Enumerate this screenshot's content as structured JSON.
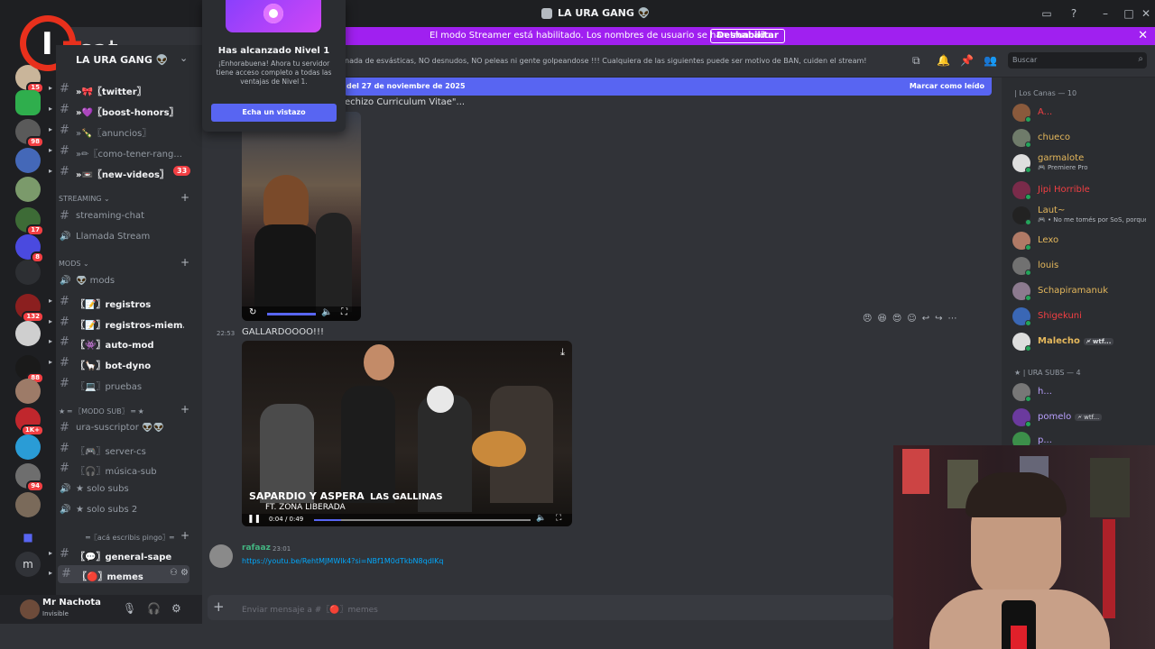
{
  "window": {
    "title": "LA URA GANG 👽"
  },
  "banner": {
    "text": "El modo Streamer está habilitado. Los nombres de usuario se han truncado.",
    "button": "Deshabilitar"
  },
  "logo": {
    "text": "I-sat"
  },
  "popup": {
    "title": "Has alcanzado Nivel 1",
    "body": "¡Enhorabuena! Ahora tu servidor tiene acceso completo a todas las ventajas de Nivel 1.",
    "button": "Echa un vistazo"
  },
  "server": {
    "name": "LA URA GANG 👽"
  },
  "rail_badges": [
    "15",
    "98",
    "17",
    "8",
    "132",
    "88",
    "1K+",
    "94"
  ],
  "channels_top": [
    {
      "label": "»🎀〖twitter〗",
      "bold": true
    },
    {
      "label": "»💜〖boost-honors〗",
      "bold": true
    },
    {
      "label": "»🍾〖anuncios〗",
      "bold": false
    },
    {
      "label": "»✏〖como-tener-rang...",
      "bold": false
    },
    {
      "label": "»📼〖new-videos〗",
      "bold": true,
      "mentions": "33"
    }
  ],
  "streaming": {
    "category": "STREAMING",
    "channels": [
      "streaming-chat",
      "Llamada Stream"
    ]
  },
  "mods": {
    "category": "mods",
    "channels": [
      {
        "label": "👽 mods",
        "bold": false
      },
      {
        "label": "〖📝〗registros",
        "bold": true
      },
      {
        "label": "〖📝〗registros-miem...",
        "bold": true
      },
      {
        "label": "〖👾〗auto-mod",
        "bold": true
      },
      {
        "label": "〖🦙〗bot-dyno",
        "bold": true
      },
      {
        "label": "〖💻〗pruebas",
        "bold": false
      }
    ]
  },
  "modosub": {
    "category": "★ ═ 〖MODO SUB〗 ═ ★",
    "channels": [
      {
        "label": "ura-suscriptor 👽👽",
        "bold": false
      },
      {
        "label": "〖🎮〗server-cs",
        "bold": false
      },
      {
        "label": "〖🎧〗música-sub",
        "bold": false
      },
      {
        "label": "★ solo subs",
        "bold": false
      },
      {
        "label": "★ solo subs 2",
        "bold": false
      }
    ]
  },
  "acaescribis": {
    "category": "═〖acá escribis pingo〗═",
    "channels": [
      {
        "label": "〖💬〗general-sape",
        "bold": true
      },
      {
        "label": "〖🔴〗memes",
        "bold": true,
        "active": true
      }
    ]
  },
  "user": {
    "name": "Mr Nachota",
    "status": "Invisible"
  },
  "header": {
    "topic": "nada de esvásticas, NO desnudos, NO peleas ni gente golpeandose !!! Cualquiera de las siguientes puede ser motivo de BAN, cuiden el stream!",
    "search_placeholder": "Buscar"
  },
  "newbar": {
    "left": "del 27 de noviembre de 2025",
    "right": "Marcar como leído"
  },
  "messages": {
    "first_text": "echizo Curriculum Vitae\"...",
    "msg2_time": "22:53",
    "msg2_text": "GALLARDOOOO!!!",
    "video2_caption1": "SAPARDIO Y ASPERA",
    "video2_caption2": "LAS GALLINAS",
    "video2_caption3": "FT. ZONA LIBERADA",
    "video2_time": "0:04 / 0:49",
    "msg3_author": "rafaaz",
    "msg3_time": "23:01",
    "msg3_link": "https://youtu.be/RehtMJMWlk4?si=NBf1M0dTkbN8qdIKq"
  },
  "composer": {
    "placeholder": "Enviar mensaje a #〖🔴〗memes"
  },
  "members": {
    "group1": "| Los Canas — 10",
    "group2": "★ | URA SUBS — 4",
    "list1": [
      {
        "name": "A...",
        "color": "#f23f43",
        "sub": "",
        "tag": "",
        "av": "#8a5a3c"
      },
      {
        "name": "chueco",
        "color": "#e5b85c",
        "sub": "",
        "tag": "",
        "av": "#6f7b6a"
      },
      {
        "name": "garmalote",
        "color": "#e5b85c",
        "sub": "🎮 Premiere Pro",
        "tag": "",
        "av": "#dedede"
      },
      {
        "name": "Jipi Horrible",
        "color": "#f23f43",
        "sub": "",
        "tag": "",
        "av": "#7a2b4a"
      },
      {
        "name": "Laut~",
        "color": "#e5b85c",
        "sub": "🎮 • No me tomés por SoS, porque...",
        "tag": "",
        "av": "#222"
      },
      {
        "name": "Lexo",
        "color": "#e5b85c",
        "sub": "",
        "tag": "",
        "av": "#b07a66"
      },
      {
        "name": "louis",
        "color": "#e5b85c",
        "sub": "",
        "tag": "",
        "av": "#717171"
      },
      {
        "name": "Schapiramanuk",
        "color": "#e5b85c",
        "sub": "",
        "tag": "",
        "av": "#8c7a8f"
      },
      {
        "name": "Shigekuni",
        "color": "#f23f43",
        "sub": "",
        "tag": "",
        "av": "#3a67b5"
      },
      {
        "name": "Malecho",
        "color": "#e5b85c",
        "sub": "",
        "tag": "🗲 wtf...",
        "av": "#ddd"
      }
    ],
    "list2": [
      {
        "name": "h...",
        "color": "#b9a0ff",
        "sub": "",
        "tag": "",
        "av": "#777"
      },
      {
        "name": "pomelo",
        "color": "#b9a0ff",
        "sub": "",
        "tag": "🗲 wtf...",
        "av": "#6b3a9e"
      },
      {
        "name": "p...",
        "color": "#b9a0ff",
        "sub": "",
        "tag": "",
        "av": "#3c8f4a"
      }
    ]
  }
}
